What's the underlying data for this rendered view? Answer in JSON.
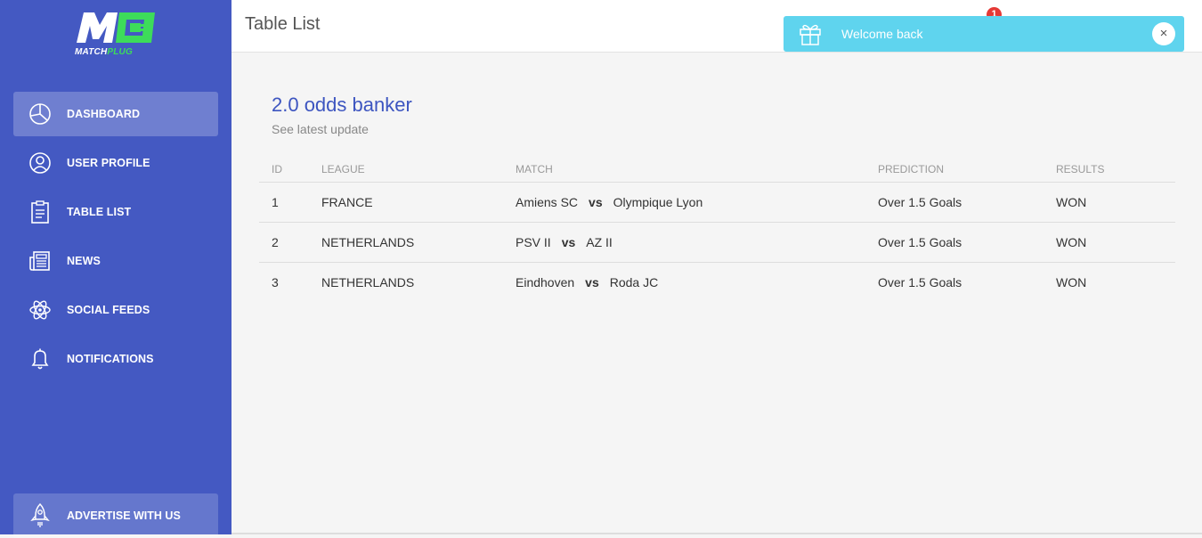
{
  "brand": {
    "logo_text_main": "MATCH",
    "logo_text_accent": "PLUG"
  },
  "sidebar": {
    "items": [
      {
        "label": "DASHBOARD",
        "icon": "pie-chart-icon",
        "active": true
      },
      {
        "label": "USER PROFILE",
        "icon": "user-icon",
        "active": false
      },
      {
        "label": "TABLE LIST",
        "icon": "clipboard-icon",
        "active": false
      },
      {
        "label": "NEWS",
        "icon": "newspaper-icon",
        "active": false
      },
      {
        "label": "SOCIAL FEEDS",
        "icon": "atom-icon",
        "active": false
      },
      {
        "label": "NOTIFICATIONS",
        "icon": "bell-icon",
        "active": false
      }
    ],
    "advertise": {
      "label": "ADVERTISE WITH US",
      "icon": "rocket-icon"
    }
  },
  "header": {
    "title": "Table List",
    "notification_count": "1"
  },
  "toast": {
    "message": "Welcome back",
    "icon": "gift-icon",
    "close": "×"
  },
  "card": {
    "title": "2.0 odds banker",
    "subtitle": "See latest update"
  },
  "table": {
    "columns": [
      "ID",
      "LEAGUE",
      "MATCH",
      "PREDICTION",
      "RESULTS"
    ],
    "rows": [
      {
        "id": "1",
        "league": "FRANCE",
        "home": "Amiens SC",
        "vs": "vs",
        "away": "Olympique Lyon",
        "prediction": "Over 1.5 Goals",
        "result": "WON"
      },
      {
        "id": "2",
        "league": "NETHERLANDS",
        "home": "PSV II",
        "vs": "vs",
        "away": "AZ II",
        "prediction": "Over 1.5 Goals",
        "result": "WON"
      },
      {
        "id": "3",
        "league": "NETHERLANDS",
        "home": "Eindhoven",
        "vs": "vs",
        "away": "Roda JC",
        "prediction": "Over 1.5 Goals",
        "result": "WON"
      }
    ]
  },
  "colors": {
    "sidebar": "#4459c2",
    "accent": "#3d55c0",
    "toast": "#5fd4ee",
    "badge": "#e53935",
    "logo_green": "#3ddc5a"
  }
}
